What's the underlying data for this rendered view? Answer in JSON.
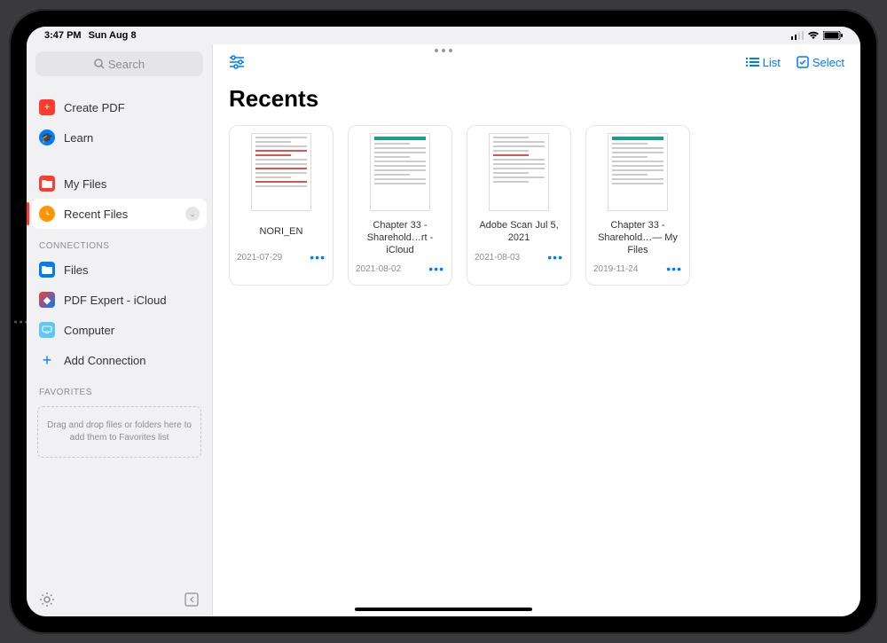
{
  "status": {
    "time": "3:47 PM",
    "date": "Sun Aug 8"
  },
  "search": {
    "placeholder": "Search"
  },
  "sidebar": {
    "top": [
      {
        "label": "Create PDF",
        "icon": "plus-doc",
        "iconClass": "icon-red"
      },
      {
        "label": "Learn",
        "icon": "learn",
        "iconClass": "icon-blue"
      }
    ],
    "files": [
      {
        "label": "My Files",
        "icon": "folder",
        "iconClass": "icon-folder-red"
      },
      {
        "label": "Recent Files",
        "icon": "clock",
        "iconClass": "icon-orange",
        "selected": true,
        "hasChevron": true
      }
    ],
    "connectionsHeader": "CONNECTIONS",
    "connections": [
      {
        "label": "Files",
        "icon": "folder",
        "iconClass": "icon-folder-blue"
      },
      {
        "label": "PDF Expert - iCloud",
        "icon": "expert",
        "iconClass": "icon-expert"
      },
      {
        "label": "Computer",
        "icon": "computer",
        "iconClass": "icon-computer"
      },
      {
        "label": "Add Connection",
        "icon": "plus",
        "iconClass": "icon-plus"
      }
    ],
    "favoritesHeader": "FAVORITES",
    "favoritesHint": "Drag and drop files or folders here to add them to Favorites list"
  },
  "toolbar": {
    "listLabel": "List",
    "selectLabel": "Select"
  },
  "page": {
    "title": "Recents"
  },
  "files": [
    {
      "name": "NORI_EN",
      "date": "2021-07-29",
      "thumbStyle": "form-red"
    },
    {
      "name": "Chapter 33 - Sharehold…rt - iCloud",
      "date": "2021-08-02",
      "thumbStyle": "teal-header"
    },
    {
      "name": "Adobe Scan Jul 5, 2021",
      "date": "2021-08-03",
      "thumbStyle": "scan"
    },
    {
      "name": "Chapter 33 - Sharehold…— My Files",
      "date": "2019-11-24",
      "thumbStyle": "teal-header"
    }
  ]
}
